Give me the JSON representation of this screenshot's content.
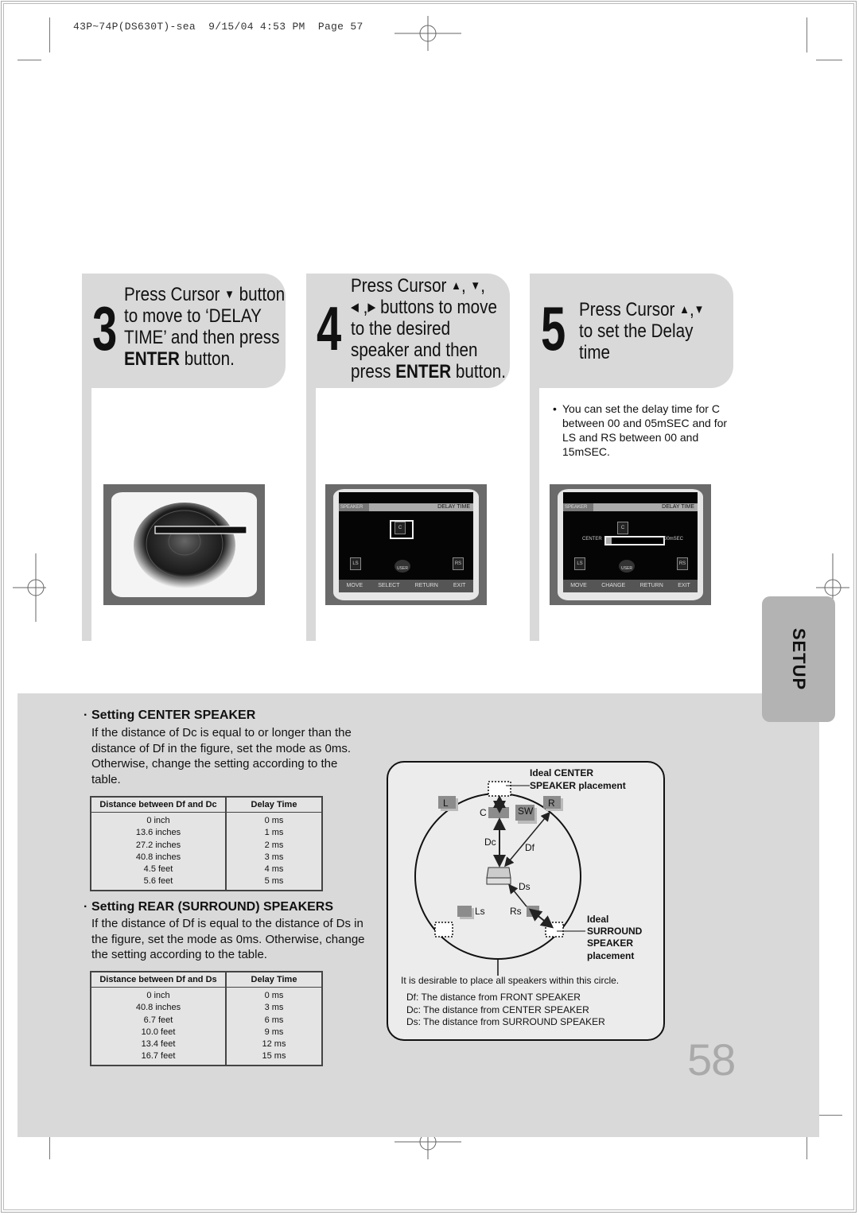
{
  "print_slug": "43P~74P(DS630T)-sea  9/15/04 4:53 PM  Page 57",
  "steps": [
    {
      "number": "3",
      "lines": [
        {
          "parts": [
            {
              "t": "Press Cursor "
            },
            {
              "icon": "down-triangle",
              "g": "▼"
            },
            {
              "t": " button"
            }
          ]
        },
        {
          "parts": [
            {
              "t": "to move to ‘DELAY"
            }
          ]
        },
        {
          "parts": [
            {
              "t": "TIME’ and then press"
            }
          ]
        },
        {
          "parts": [
            {
              "t": "ENTER",
              "bold": true
            },
            {
              "t": " button."
            }
          ]
        }
      ],
      "screen": {
        "type": "speaker-image"
      }
    },
    {
      "number": "4",
      "lines": [
        {
          "parts": [
            {
              "t": "Press Cursor "
            },
            {
              "icon": "up-triangle",
              "g": "▲"
            },
            {
              "t": ", "
            },
            {
              "icon": "down-triangle",
              "g": "▼"
            },
            {
              "t": ","
            }
          ]
        },
        {
          "parts": [
            {
              "icon": "left-triangle",
              "g": "◀"
            },
            {
              "t": " ,"
            },
            {
              "icon": "right-triangle",
              "g": "▶"
            },
            {
              "t": " buttons to move"
            }
          ]
        },
        {
          "parts": [
            {
              "t": "to the desired"
            }
          ]
        },
        {
          "parts": [
            {
              "t": "speaker and then"
            }
          ]
        },
        {
          "parts": [
            {
              "t": "press "
            },
            {
              "t": "ENTER",
              "bold": true
            },
            {
              "t": " button."
            }
          ]
        }
      ],
      "screen": {
        "type": "osd",
        "header_left": "SPEAKER",
        "header_right": "DELAY TIME",
        "icons": {
          "center": "C",
          "left_surround": "LS",
          "right_surround": "RS",
          "user": "USER"
        },
        "footer": [
          "MOVE",
          "SELECT",
          "RETURN",
          "EXIT"
        ]
      }
    },
    {
      "number": "5",
      "lines": [
        {
          "parts": [
            {
              "t": "Press Cursor "
            },
            {
              "icon": "up-triangle",
              "g": "▲"
            },
            {
              "t": ","
            },
            {
              "icon": "down-triangle",
              "g": "▼"
            }
          ]
        },
        {
          "parts": [
            {
              "t": "to set the Delay"
            }
          ]
        },
        {
          "parts": [
            {
              "t": "time"
            }
          ]
        }
      ],
      "bullet": "You can set the delay time for C between 00 and 05mSEC and for LS and RS between 00 and 15mSEC.",
      "screen": {
        "type": "osd",
        "header_left": "SPEAKER",
        "header_right": "DELAY TIME",
        "icons": {
          "center": "C",
          "left_surround": "LS",
          "right_surround": "RS",
          "user": "USER"
        },
        "slider_label": "CENTER",
        "slider_value": "00mSEC",
        "slider_fraction": 0.0,
        "footer": [
          "MOVE",
          "CHANGE",
          "RETURN",
          "EXIT"
        ]
      }
    }
  ],
  "setup_tab": "SETUP",
  "center_section": {
    "title": "Setting CENTER SPEAKER",
    "body": "If the distance of Dc is equal to or longer than the distance of Df in the figure, set the mode as 0ms. Otherwise, change the setting according to the table.",
    "table": {
      "headers": [
        "Distance between Df and Dc",
        "Delay Time"
      ],
      "rows": [
        [
          "0 inch",
          "0 ms"
        ],
        [
          "13.6 inches",
          "1 ms"
        ],
        [
          "27.2 inches",
          "2 ms"
        ],
        [
          "40.8 inches",
          "3 ms"
        ],
        [
          "4.5 feet",
          "4 ms"
        ],
        [
          "5.6 feet",
          "5 ms"
        ]
      ]
    }
  },
  "rear_section": {
    "title": "Setting REAR (SURROUND) SPEAKERS",
    "body": "If the distance of Df is equal to the distance of Ds in the figure, set the mode as 0ms. Otherwise, change the setting according to the table.",
    "table": {
      "headers": [
        "Distance between Df and Ds",
        "Delay Time"
      ],
      "rows": [
        [
          "0 inch",
          "0 ms"
        ],
        [
          "40.8 inches",
          "3 ms"
        ],
        [
          "6.7 feet",
          "6 ms"
        ],
        [
          "10.0 feet",
          "9 ms"
        ],
        [
          "13.4 feet",
          "12 ms"
        ],
        [
          "16.7 feet",
          "15 ms"
        ]
      ]
    }
  },
  "diagram": {
    "ideal_center_label": [
      "Ideal CENTER",
      "SPEAKER placement"
    ],
    "ideal_surround_label": [
      "Ideal",
      "SURROUND",
      "SPEAKER",
      "placement"
    ],
    "speakers": {
      "left": "L",
      "right": "R",
      "center": "C",
      "subwoofer": "SW",
      "left_surround": "Ls",
      "right_surround": "Rs"
    },
    "distances": {
      "center": "Dc",
      "front": "Df",
      "surround": "Ds"
    },
    "circle_note": "It is desirable to place all speakers within this circle.",
    "legend": [
      "Df: The distance from FRONT SPEAKER",
      "Dc: The distance from CENTER SPEAKER",
      "Ds: The distance from SURROUND SPEAKER"
    ]
  },
  "page_number": "58"
}
